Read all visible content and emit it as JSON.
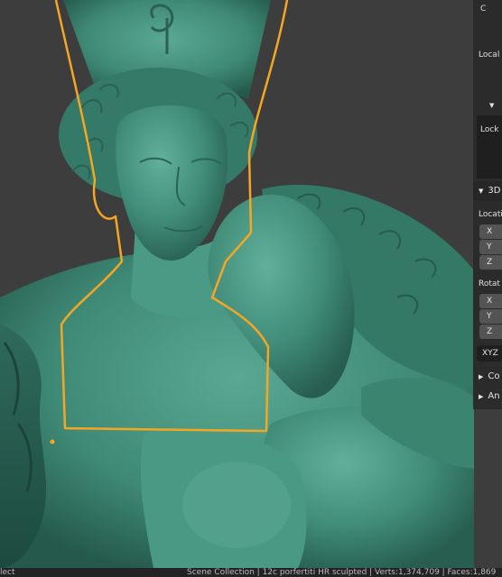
{
  "viewport": {
    "accent_outline": "#f5a623",
    "mesh_color": "#3f8a76",
    "background": "#3d3d3d"
  },
  "sidebar": {
    "top_label": "C",
    "local_label": "Local",
    "lock_label": "Lock",
    "section_3d": "3D",
    "location_label": "Locati",
    "rotation_label": "Rotat",
    "axis_x": "X",
    "axis_y": "Y",
    "axis_z": "Z",
    "rotation_mode": "XYZ",
    "collapsed_1": "Co",
    "collapsed_2": "An"
  },
  "statusbar": {
    "left_text": "lect",
    "right_text": "Scene Collection | 12c porfertiti HR sculpted | Verts:1,374,709 | Faces:1,869"
  }
}
